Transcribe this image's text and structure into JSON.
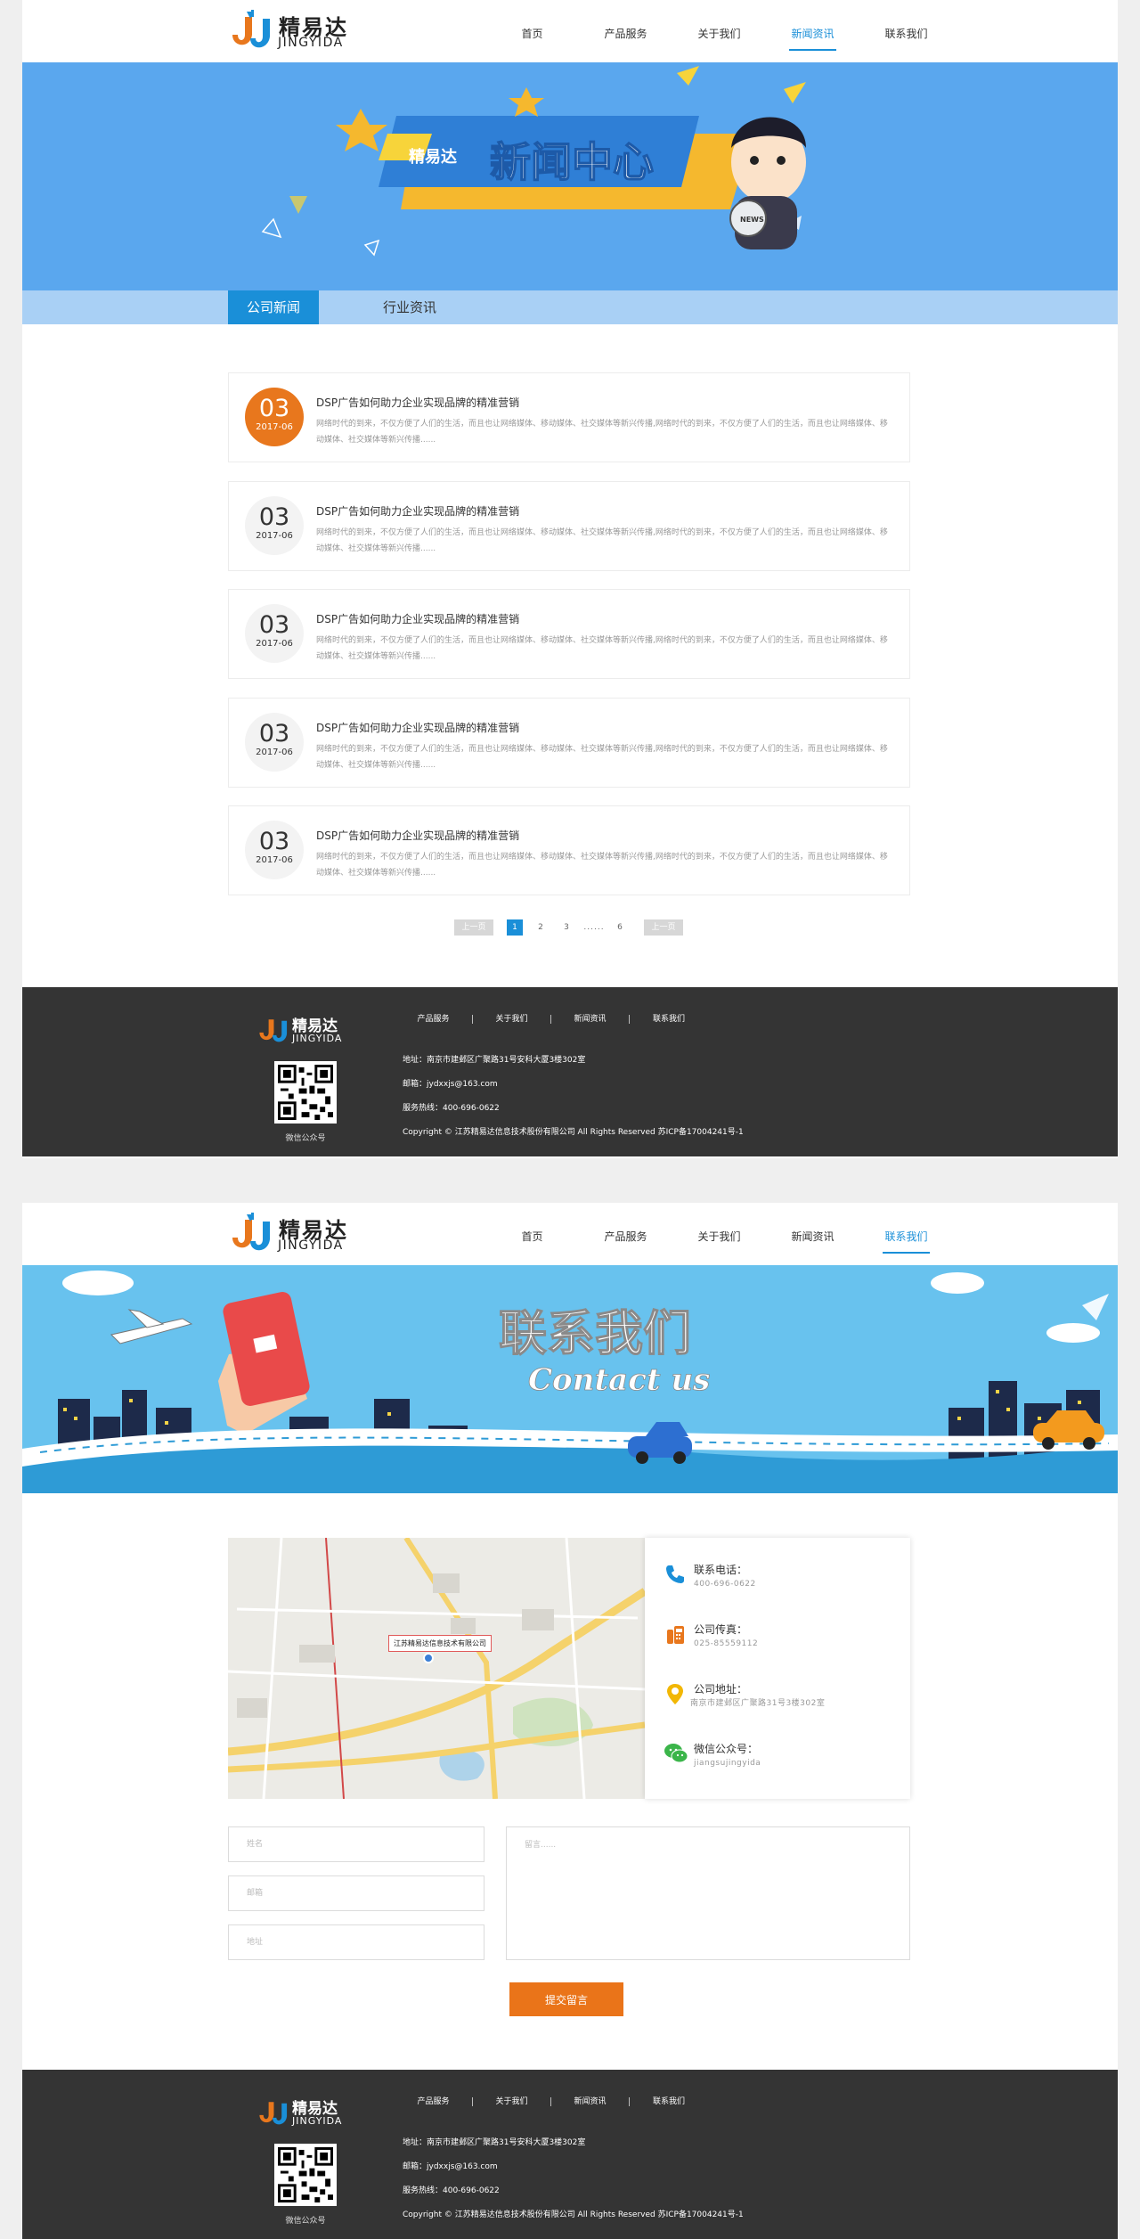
{
  "brand": {
    "name_cn": "精易达",
    "name_en": "JINGYIDA"
  },
  "nav": [
    "首页",
    "产品服务",
    "关于我们",
    "新闻资讯",
    "联系我们"
  ],
  "news_page": {
    "banner": {
      "tag": "精易达",
      "title": "新闻中心",
      "mic_text": "NEWS"
    },
    "tabs": {
      "active": "公司新闻",
      "inactive": "行业资讯"
    },
    "items": [
      {
        "day": "03",
        "ym": "2017-06",
        "title": "DSP广告如何助力企业实现品牌的精准营销",
        "desc": "网络时代的到来，不仅方便了人们的生活，而且也让网络媒体、移动媒体、社交媒体等新兴传播,网络时代的到来，不仅方便了人们的生活，而且也让网络媒体、移动媒体、社交媒体等新兴传播......"
      },
      {
        "day": "03",
        "ym": "2017-06",
        "title": "DSP广告如何助力企业实现品牌的精准营销",
        "desc": "网络时代的到来，不仅方便了人们的生活，而且也让网络媒体、移动媒体、社交媒体等新兴传播,网络时代的到来，不仅方便了人们的生活，而且也让网络媒体、移动媒体、社交媒体等新兴传播......"
      },
      {
        "day": "03",
        "ym": "2017-06",
        "title": "DSP广告如何助力企业实现品牌的精准营销",
        "desc": "网络时代的到来，不仅方便了人们的生活，而且也让网络媒体、移动媒体、社交媒体等新兴传播,网络时代的到来，不仅方便了人们的生活，而且也让网络媒体、移动媒体、社交媒体等新兴传播......"
      },
      {
        "day": "03",
        "ym": "2017-06",
        "title": "DSP广告如何助力企业实现品牌的精准营销",
        "desc": "网络时代的到来，不仅方便了人们的生活，而且也让网络媒体、移动媒体、社交媒体等新兴传播,网络时代的到来，不仅方便了人们的生活，而且也让网络媒体、移动媒体、社交媒体等新兴传播......"
      },
      {
        "day": "03",
        "ym": "2017-06",
        "title": "DSP广告如何助力企业实现品牌的精准营销",
        "desc": "网络时代的到来，不仅方便了人们的生活，而且也让网络媒体、移动媒体、社交媒体等新兴传播,网络时代的到来，不仅方便了人们的生活，而且也让网络媒体、移动媒体、社交媒体等新兴传播......"
      }
    ],
    "pagination": {
      "prev": "上一页",
      "pages": [
        "1",
        "2",
        "3"
      ],
      "ellipsis": "......",
      "last": "6",
      "next": "上一页",
      "current": "1"
    }
  },
  "footer": {
    "nav": [
      "产品服务",
      "关于我们",
      "新闻资讯",
      "联系我们"
    ],
    "address": "地址：南京市建邺区广聚路31号安科大厦3楼302室",
    "email": "邮箱：jydxxjs@163.com",
    "hotline": "服务热线：400-696-0622",
    "copyright": "Copyright © 江苏精易达信息技术股份有限公司 All Rights Reserved 苏ICP备17004241号-1",
    "qr_label": "微信公众号"
  },
  "contact_page": {
    "banner": {
      "title": "联系我们",
      "subtitle": "Contact us"
    },
    "map_label": "江苏精易达信息技术有限公司",
    "info": [
      {
        "icon": "phone-icon",
        "label": "联系电话：",
        "value": "400-696-0622"
      },
      {
        "icon": "fax-icon",
        "label": "公司传真：",
        "value": "025-85559112"
      },
      {
        "icon": "location-pin-icon",
        "label": "公司地址：",
        "value": "南京市建邺区广聚路31号3楼302室"
      },
      {
        "icon": "wechat-icon",
        "label": "微信公众号：",
        "value": "jiangsujingyida"
      }
    ],
    "form": {
      "name_placeholder": "姓名",
      "email_placeholder": "邮箱",
      "address_placeholder": "地址",
      "message_placeholder": "留言......",
      "submit": "提交留言"
    }
  },
  "colors": {
    "accent": "#1a8fd8",
    "orange": "#e8771d",
    "footer_bg": "#343434",
    "news_banner": "#5aa7ee",
    "contact_banner": "#68c2ee"
  }
}
